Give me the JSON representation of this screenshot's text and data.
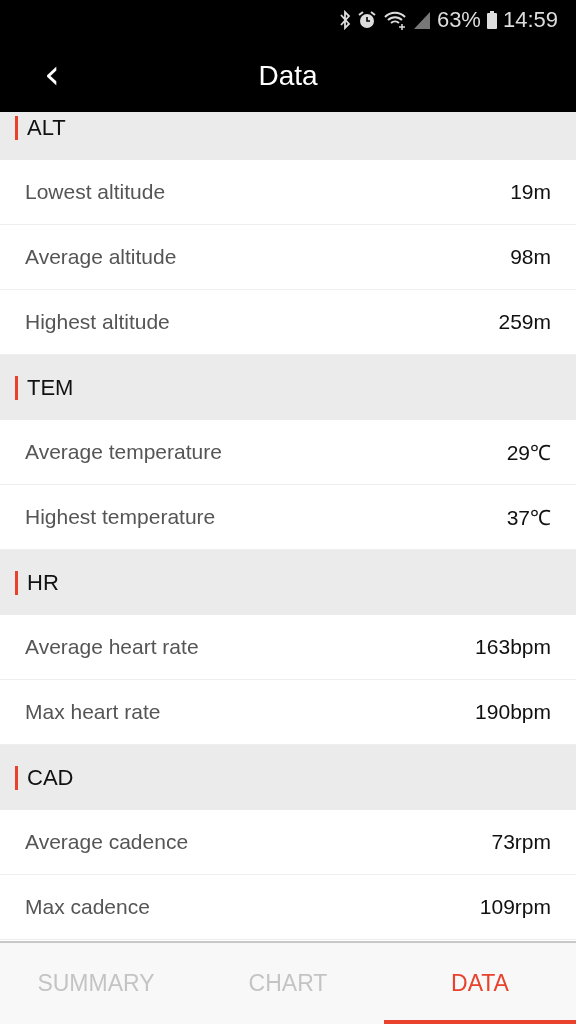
{
  "status_bar": {
    "battery": "63%",
    "time": "14:59"
  },
  "header": {
    "back": "‹",
    "title": "Data"
  },
  "sections": [
    {
      "title": "ALT",
      "rows": [
        {
          "label": "Lowest altitude",
          "value": "19m"
        },
        {
          "label": "Average altitude",
          "value": "98m"
        },
        {
          "label": "Highest altitude",
          "value": "259m"
        }
      ]
    },
    {
      "title": "TEM",
      "rows": [
        {
          "label": "Average temperature",
          "value": "29℃"
        },
        {
          "label": "Highest temperature",
          "value": "37℃"
        }
      ]
    },
    {
      "title": "HR",
      "rows": [
        {
          "label": "Average heart rate",
          "value": "163bpm"
        },
        {
          "label": "Max heart rate",
          "value": "190bpm"
        }
      ]
    },
    {
      "title": "CAD",
      "rows": [
        {
          "label": "Average cadence",
          "value": "73rpm"
        },
        {
          "label": "Max cadence",
          "value": "109rpm"
        }
      ]
    }
  ],
  "tabs": [
    {
      "label": "SUMMARY",
      "selected": false
    },
    {
      "label": "CHART",
      "selected": false
    },
    {
      "label": "DATA",
      "selected": true
    }
  ]
}
